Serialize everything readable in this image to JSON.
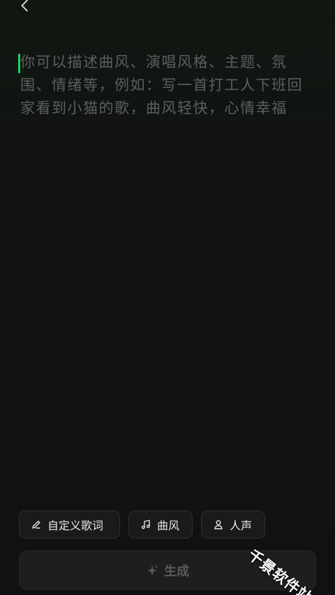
{
  "header": {
    "back_icon": "chevron-left-icon"
  },
  "prompt": {
    "placeholder": "你可以描述曲风、演唱风格、主题、氛围、情绪等，例如：写一首打工人下班回家看到小猫的歌，曲风轻快，心情幸福",
    "value": "",
    "caret_color": "#1fd35c"
  },
  "options": {
    "lyrics": {
      "label": "自定义歌词",
      "icon": "pencil-icon"
    },
    "style": {
      "label": "曲风",
      "icon": "music-note-icon"
    },
    "vocal": {
      "label": "人声",
      "icon": "person-icon"
    }
  },
  "generate": {
    "label": "生成",
    "icon": "sparkle-icon"
  },
  "watermark": {
    "text": "千景软件站"
  },
  "colors": {
    "background": "#121212",
    "accent": "#1fd35c",
    "placeholder_text": "#5d5f5e",
    "chip_text": "#e8e8e8",
    "disabled_text": "#5a5a5a"
  }
}
